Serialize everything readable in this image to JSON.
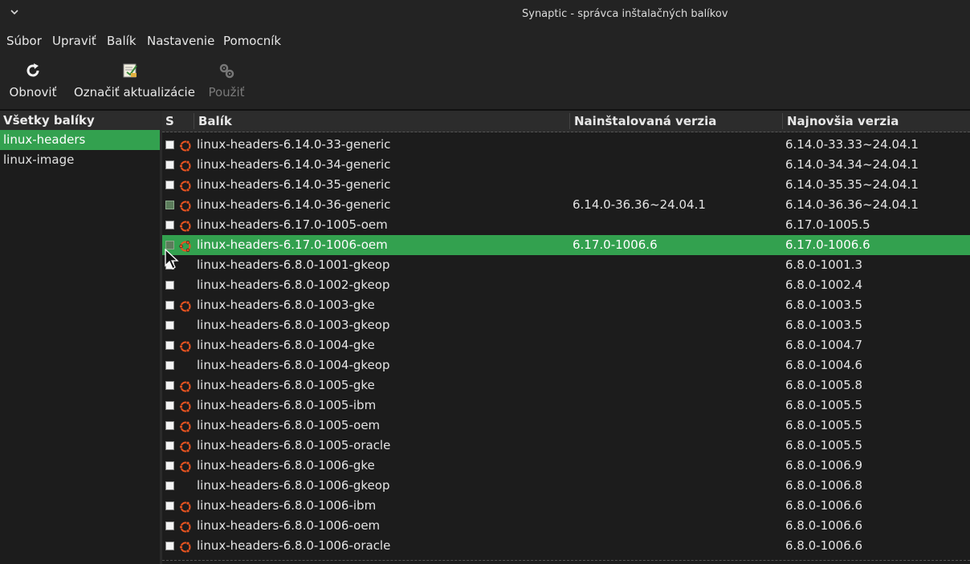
{
  "window": {
    "title": "Synaptic - správca inštalačných balíkov"
  },
  "menu": [
    "Súbor",
    "Upraviť",
    "Balík",
    "Nastavenie",
    "Pomocník"
  ],
  "toolbar": {
    "reload": "Obnoviť",
    "mark_upgrades": "Označiť aktualizácie",
    "apply": "Použiť"
  },
  "sidebar": {
    "header": "Všetky balíky",
    "items": [
      "linux-headers",
      "linux-image"
    ]
  },
  "table": {
    "columns": {
      "status": "S",
      "package": "Balík",
      "installed": "Nainštalovaná verzia",
      "latest": "Najnovšia verzia"
    },
    "rows": [
      {
        "name": "linux-headers-6.14.0-33-generic",
        "installed": "",
        "latest": "6.14.0-33.33~24.04.1",
        "status": "not-installed",
        "ubuntu": true
      },
      {
        "name": "linux-headers-6.14.0-34-generic",
        "installed": "",
        "latest": "6.14.0-34.34~24.04.1",
        "status": "not-installed",
        "ubuntu": true
      },
      {
        "name": "linux-headers-6.14.0-35-generic",
        "installed": "",
        "latest": "6.14.0-35.35~24.04.1",
        "status": "not-installed",
        "ubuntu": true
      },
      {
        "name": "linux-headers-6.14.0-36-generic",
        "installed": "6.14.0-36.36~24.04.1",
        "latest": "6.14.0-36.36~24.04.1",
        "status": "installed",
        "ubuntu": true
      },
      {
        "name": "linux-headers-6.17.0-1005-oem",
        "installed": "",
        "latest": "6.17.0-1005.5",
        "status": "not-installed",
        "ubuntu": true
      },
      {
        "name": "linux-headers-6.17.0-1006-oem",
        "installed": "6.17.0-1006.6",
        "latest": "6.17.0-1006.6",
        "status": "installed",
        "ubuntu": true,
        "selected": true
      },
      {
        "name": "linux-headers-6.8.0-1001-gkeop",
        "installed": "",
        "latest": "6.8.0-1001.3",
        "status": "not-installed",
        "ubuntu": false
      },
      {
        "name": "linux-headers-6.8.0-1002-gkeop",
        "installed": "",
        "latest": "6.8.0-1002.4",
        "status": "not-installed",
        "ubuntu": false
      },
      {
        "name": "linux-headers-6.8.0-1003-gke",
        "installed": "",
        "latest": "6.8.0-1003.5",
        "status": "not-installed",
        "ubuntu": true
      },
      {
        "name": "linux-headers-6.8.0-1003-gkeop",
        "installed": "",
        "latest": "6.8.0-1003.5",
        "status": "not-installed",
        "ubuntu": false
      },
      {
        "name": "linux-headers-6.8.0-1004-gke",
        "installed": "",
        "latest": "6.8.0-1004.7",
        "status": "not-installed",
        "ubuntu": true
      },
      {
        "name": "linux-headers-6.8.0-1004-gkeop",
        "installed": "",
        "latest": "6.8.0-1004.6",
        "status": "not-installed",
        "ubuntu": false
      },
      {
        "name": "linux-headers-6.8.0-1005-gke",
        "installed": "",
        "latest": "6.8.0-1005.8",
        "status": "not-installed",
        "ubuntu": true
      },
      {
        "name": "linux-headers-6.8.0-1005-ibm",
        "installed": "",
        "latest": "6.8.0-1005.5",
        "status": "not-installed",
        "ubuntu": true
      },
      {
        "name": "linux-headers-6.8.0-1005-oem",
        "installed": "",
        "latest": "6.8.0-1005.5",
        "status": "not-installed",
        "ubuntu": true
      },
      {
        "name": "linux-headers-6.8.0-1005-oracle",
        "installed": "",
        "latest": "6.8.0-1005.5",
        "status": "not-installed",
        "ubuntu": true
      },
      {
        "name": "linux-headers-6.8.0-1006-gke",
        "installed": "",
        "latest": "6.8.0-1006.9",
        "status": "not-installed",
        "ubuntu": true
      },
      {
        "name": "linux-headers-6.8.0-1006-gkeop",
        "installed": "",
        "latest": "6.8.0-1006.8",
        "status": "not-installed",
        "ubuntu": false
      },
      {
        "name": "linux-headers-6.8.0-1006-ibm",
        "installed": "",
        "latest": "6.8.0-1006.6",
        "status": "not-installed",
        "ubuntu": true
      },
      {
        "name": "linux-headers-6.8.0-1006-oem",
        "installed": "",
        "latest": "6.8.0-1006.6",
        "status": "not-installed",
        "ubuntu": true
      },
      {
        "name": "linux-headers-6.8.0-1006-oracle",
        "installed": "",
        "latest": "6.8.0-1006.6",
        "status": "not-installed",
        "ubuntu": true
      }
    ]
  },
  "colors": {
    "selection": "#33a14f",
    "ubuntu_orange": "#e95420",
    "background": "#1c1c1c"
  },
  "icons": {
    "reload": "reload-icon",
    "mark_upgrades": "mark-upgrades-icon",
    "apply": "apply-icon",
    "package": "ubuntu-logo-icon"
  }
}
